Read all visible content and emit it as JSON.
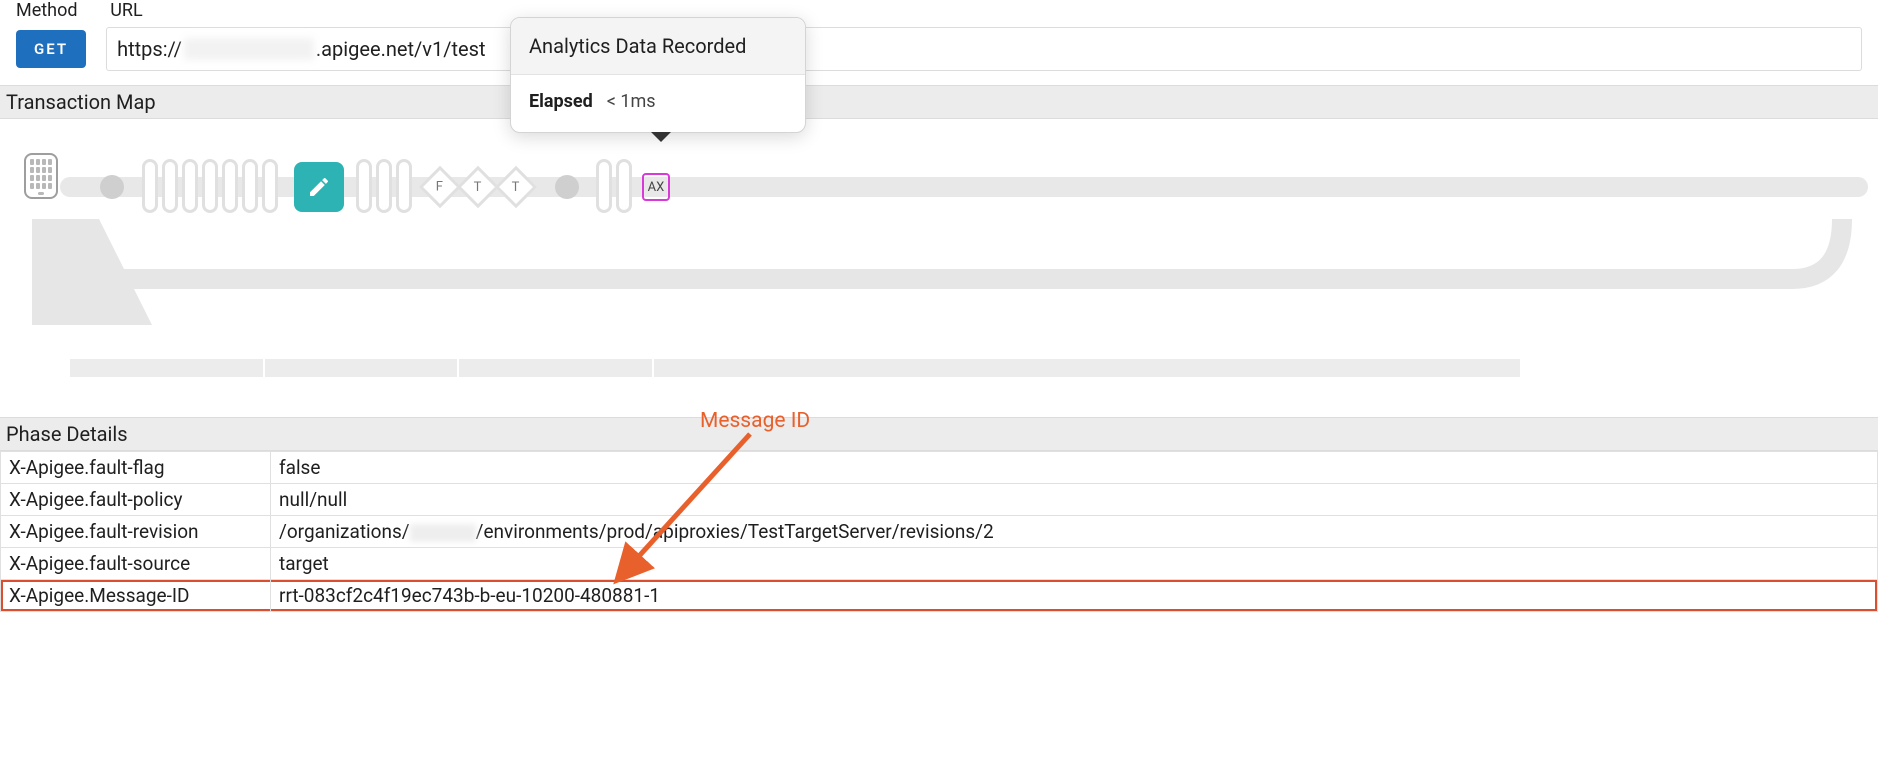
{
  "top": {
    "method_label": "Method",
    "url_label": "URL",
    "method_button": "GET",
    "url_prefix": "https://",
    "url_suffix": ".apigee.net/v1/test"
  },
  "tooltip": {
    "title": "Analytics Data Recorded",
    "elapsed_label": "Elapsed",
    "elapsed_value": "< 1ms"
  },
  "sections": {
    "transaction_map": "Transaction Map",
    "phase_details": "Phase Details"
  },
  "map": {
    "diamonds": [
      "F",
      "T",
      "T"
    ],
    "ax": "AX"
  },
  "annotation": {
    "label": "Message ID"
  },
  "phase_details": [
    {
      "key": "X-Apigee.fault-flag",
      "value": "false"
    },
    {
      "key": "X-Apigee.fault-policy",
      "value": "null/null"
    },
    {
      "key": "X-Apigee.fault-revision",
      "prefix": "/organizations/",
      "suffix": "/environments/prod/apiproxies/TestTargetServer/revisions/2",
      "redacted": true
    },
    {
      "key": "X-Apigee.fault-source",
      "value": "target"
    },
    {
      "key": "X-Apigee.Message-ID",
      "value": "rrt-083cf2c4f19ec743b-b-eu-10200-480881-1",
      "highlight": true
    }
  ]
}
